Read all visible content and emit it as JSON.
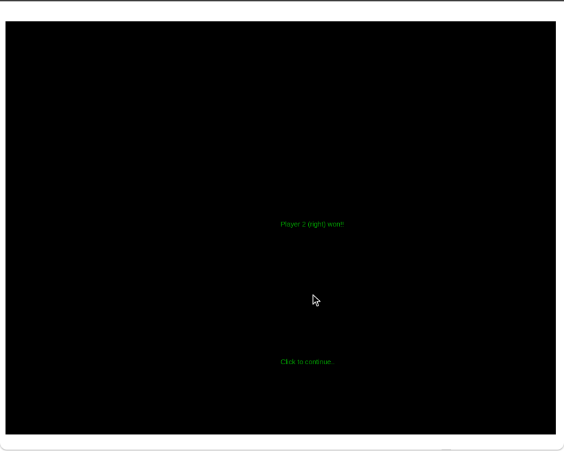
{
  "game": {
    "background_color": "#000000",
    "text_color": "#00a000",
    "winner_message": "Player 2 (right) won!!",
    "continue_prompt": "Click to continue.."
  },
  "cursor": {
    "icon": "arrow-pointer-icon"
  }
}
